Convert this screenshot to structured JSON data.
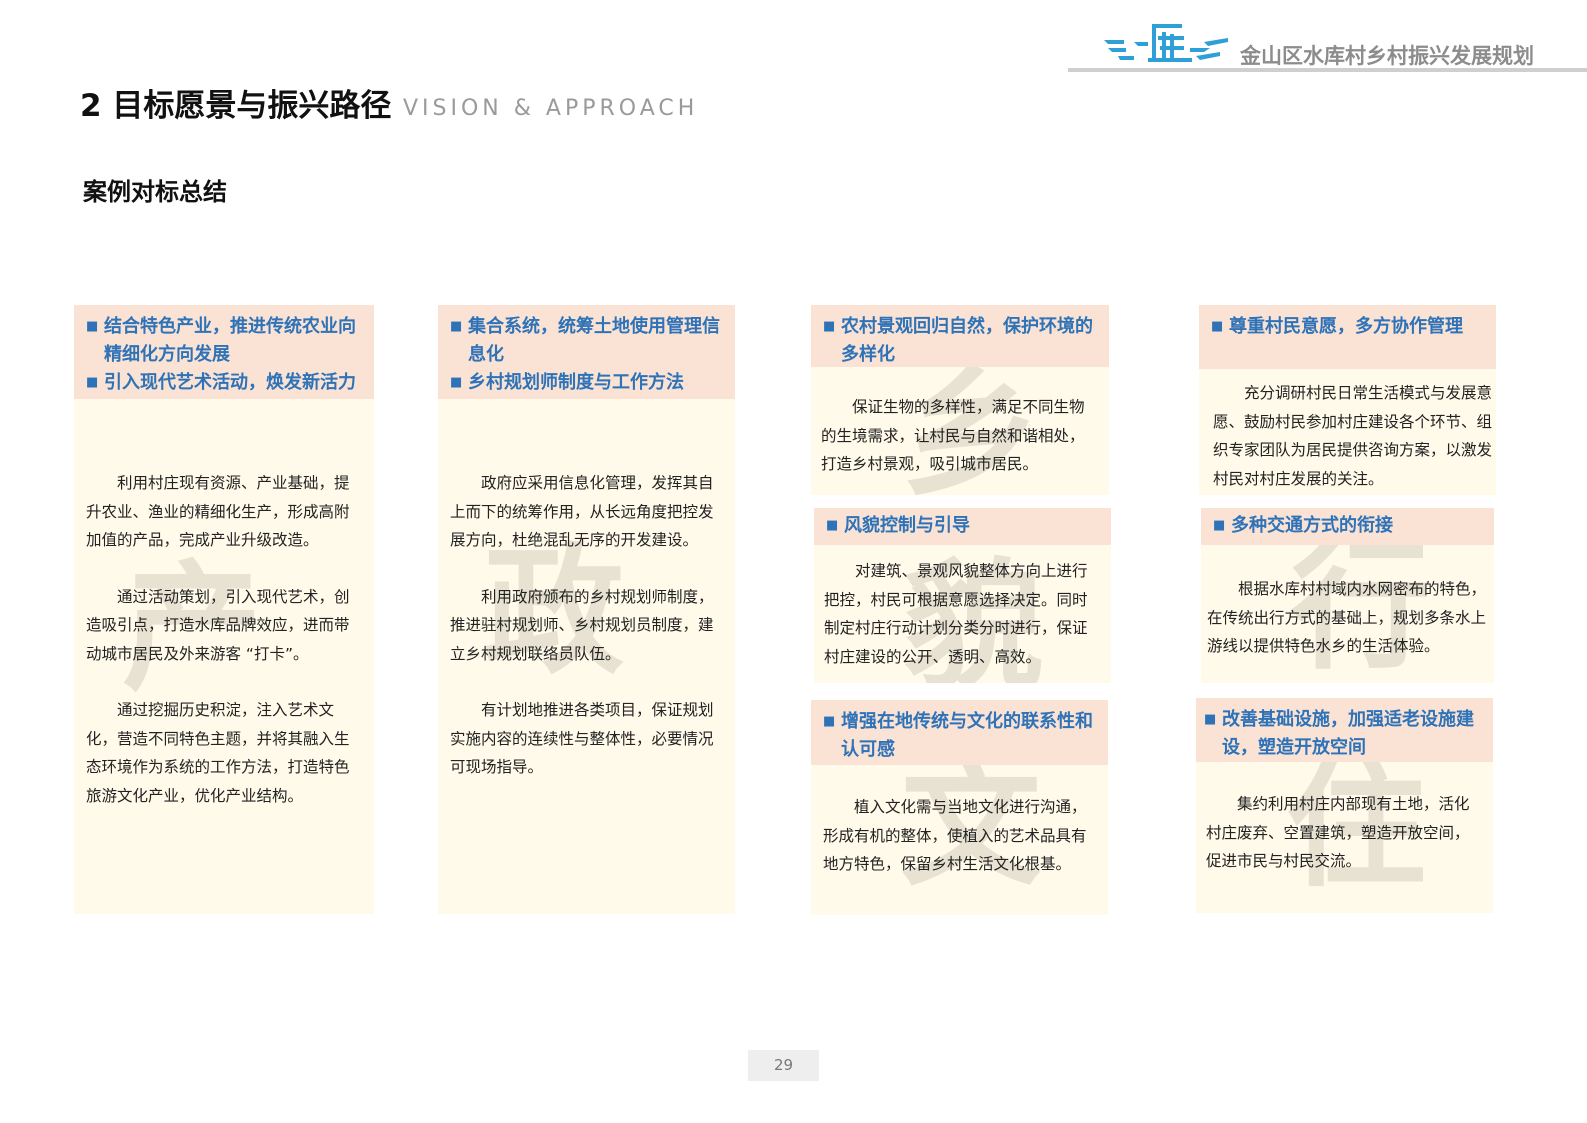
{
  "header": {
    "doc_title": "金山区水库村乡村振兴发展规划",
    "logo_text": "库"
  },
  "section": {
    "title": "2 目标愿景与振兴路径",
    "title_en": "VISION & APPROACH",
    "subtitle": "案例对标总结"
  },
  "columns": [
    {
      "watermark": "产",
      "cards": [
        {
          "headings": [
            "结合特色产业，推进传统农业向精细化方向发展",
            "引入现代艺术活动，焕发新活力"
          ],
          "paragraphs": [
            "利用村庄现有资源、产业基础，提升农业、渔业的精细化生产，形成高附加值的产品，完成产业升级改造。",
            "通过活动策划，引入现代艺术，创造吸引点，打造水库品牌效应，进而带动城市居民及外来游客 “打卡”。",
            "通过挖掘历史积淀，注入艺术文化，营造不同特色主题，并将其融入生态环境作为系统的工作方法，打造特色旅游文化产业，优化产业结构。"
          ]
        }
      ]
    },
    {
      "watermark": "政",
      "cards": [
        {
          "headings": [
            "集合系统，统筹土地使用管理信息化",
            "乡村规划师制度与工作方法"
          ],
          "paragraphs": [
            "政府应采用信息化管理，发挥其自上而下的统筹作用，从长远角度把控发展方向，杜绝混乱无序的开发建设。",
            "利用政府颁布的乡村规划师制度，推进驻村规划师、乡村规划员制度，建立乡村规划联络员队伍。",
            "有计划地推进各类项目，保证规划实施内容的连续性与整体性，必要情况可现场指导。"
          ]
        }
      ]
    },
    {
      "watermarks": [
        "乡",
        "貌",
        "文"
      ],
      "cards": [
        {
          "headings": [
            "农村景观回归自然，保护环境的多样化"
          ],
          "paragraphs": [
            "保证生物的多样性，满足不同生物的生境需求，让村民与自然和谐相处，打造乡村景观，吸引城市居民。"
          ]
        },
        {
          "headings": [
            "风貌控制与引导"
          ],
          "paragraphs": [
            "对建筑、景观风貌整体方向上进行把控，村民可根据意愿选择决定。同时制定村庄行动计划分类分时进行，保证村庄建设的公开、透明、高效。"
          ]
        },
        {
          "headings": [
            "增强在地传统与文化的联系性和认可感"
          ],
          "paragraphs": [
            "植入文化需与当地文化进行沟通，形成有机的整体，使植入的艺术品具有地方特色，保留乡村生活文化根基。"
          ]
        }
      ]
    },
    {
      "watermarks": [
        "行",
        "住"
      ],
      "cards": [
        {
          "headings": [
            "尊重村民意愿，多方协作管理"
          ],
          "paragraphs": [
            "充分调研村民日常生活模式与发展意愿、鼓励村民参加村庄建设各个环节、组织专家团队为居民提供咨询方案，以激发村民对村庄发展的关注。"
          ]
        },
        {
          "headings": [
            "多种交通方式的衔接"
          ],
          "paragraphs": [
            "根据水库村村域内水网密布的特色，在传统出行方式的基础上，规划多条水上游线以提供特色水乡的生活体验。"
          ]
        },
        {
          "headings": [
            "改善基础设施，加强适老设施建设，塑造开放空间"
          ],
          "paragraphs": [
            "集约利用村庄内部现有土地，活化村庄废弃、空置建筑，塑造开放空间，促进市民与村民交流。"
          ]
        }
      ]
    }
  ],
  "footer": {
    "page_number": "29"
  },
  "colors": {
    "heading_blue": "#2e72b8",
    "card_bg": "#fffaea",
    "heading_bg": "#fae3d4",
    "watermark": "#e8e2d3",
    "logo_blue": "#2f9fd8"
  }
}
